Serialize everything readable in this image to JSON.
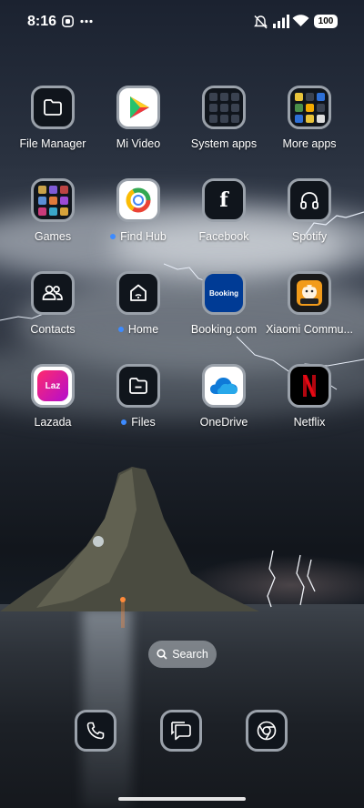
{
  "status_bar": {
    "time": "8:16",
    "battery": "100",
    "icons": [
      "screen-record-icon",
      "more-dots-icon",
      "mute-icon",
      "signal-icon",
      "wifi-icon",
      "battery-icon"
    ]
  },
  "apps": {
    "file_manager": "File Manager",
    "mi_video": "Mi Video",
    "system_apps": "System apps",
    "more_apps": "More apps",
    "games": "Games",
    "find_hub": "Find Hub",
    "facebook": "Facebook",
    "spotify": "Spotify",
    "contacts": "Contacts",
    "home": "Home",
    "booking": "Booking.com",
    "xiaomi_community": "Xiaomi Commu...",
    "lazada": "Lazada",
    "files": "Files",
    "onedrive": "OneDrive",
    "netflix": "Netflix"
  },
  "icon_text": {
    "booking": "Booking",
    "lazada": "Laz",
    "facebook": "f"
  },
  "search": {
    "label": "Search"
  },
  "dock": [
    "phone-icon",
    "messages-icon",
    "chrome-icon"
  ],
  "colors": {
    "new_dot": "#3d8bff",
    "icon_border": "#9aa1aa",
    "icon_bg": "#10151c"
  }
}
